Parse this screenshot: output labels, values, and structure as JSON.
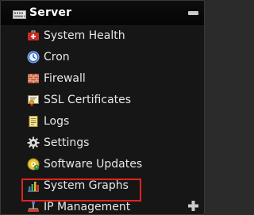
{
  "panel": {
    "title": "Server",
    "title_icon": "server-rack-icon",
    "collapse_icon": "minus-icon",
    "expand_icon": "plus-icon"
  },
  "menu": {
    "items": [
      {
        "label": "System Health",
        "icon": "first-aid-kit-icon"
      },
      {
        "label": "Cron",
        "icon": "clock-icon"
      },
      {
        "label": "Firewall",
        "icon": "brick-wall-icon"
      },
      {
        "label": "SSL Certificates",
        "icon": "certificate-icon"
      },
      {
        "label": "Logs",
        "icon": "document-icon"
      },
      {
        "label": "Settings",
        "icon": "gear-icon"
      },
      {
        "label": "Software Updates",
        "icon": "update-disc-icon"
      },
      {
        "label": "System Graphs",
        "icon": "bar-chart-icon"
      },
      {
        "label": "IP Management",
        "icon": "network-icon"
      }
    ],
    "highlighted_item": "Software Updates"
  },
  "colors": {
    "background": "#161616",
    "text": "#e8e8e8",
    "highlight_border": "#e0241e"
  }
}
